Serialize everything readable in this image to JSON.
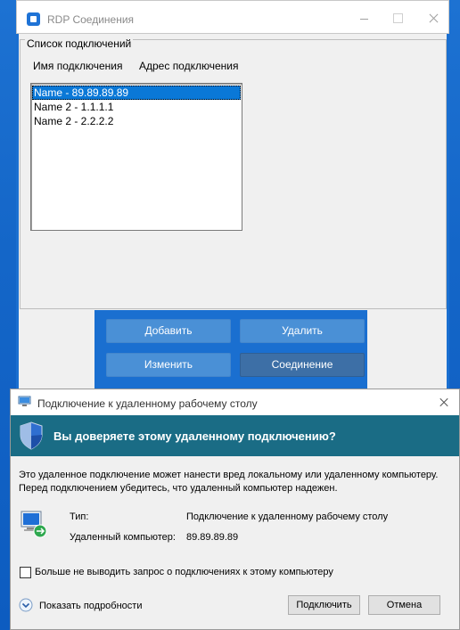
{
  "rdp_window": {
    "title": "RDP Соединения",
    "group_title": "Список подключений",
    "columns": [
      "Имя подключения",
      "Адрес подключения"
    ],
    "connections": [
      {
        "label": "Name - 89.89.89.89",
        "selected": true
      },
      {
        "label": "Name 2 - 1.1.1.1",
        "selected": false
      },
      {
        "label": "Name 2 - 2.2.2.2",
        "selected": false
      }
    ],
    "buttons": {
      "add": "Добавить",
      "delete": "Удалить",
      "edit": "Изменить",
      "connect": "Соединение"
    }
  },
  "rdc_dialog": {
    "title": "Подключение к удаленному рабочему столу",
    "banner": "Вы доверяете этому удаленному подключению?",
    "warning_line1": "Это удаленное подключение может нанести вред локальному или удаленному компьютеру.",
    "warning_line2": "Перед подключением убедитесь, что удаленный компьютер надежен.",
    "type_label": "Тип:",
    "type_value": "Подключение к удаленному рабочему столу",
    "remote_label": "Удаленный компьютер:",
    "remote_value": "89.89.89.89",
    "checkbox_label": "Больше не выводить запрос о подключениях к этому компьютеру",
    "checkbox_checked": false,
    "details_label": "Показать подробности",
    "connect_button": "Подключить",
    "cancel_button": "Отмена"
  },
  "colors": {
    "desktop": "#1466c8",
    "banner": "#1a6c85",
    "button_blue": "#4a90d6",
    "button_blue_active": "#3d6fa6",
    "selection": "#0a78d7"
  }
}
